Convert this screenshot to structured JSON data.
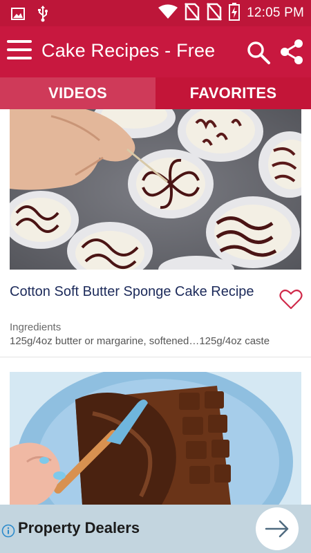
{
  "status_bar": {
    "time": "12:05 PM",
    "icons": [
      "image-icon",
      "usb-icon",
      "wifi-icon",
      "no-sim-icon",
      "no-sim-icon",
      "battery-charging-icon"
    ]
  },
  "app_bar": {
    "title": "Cake Recipes - Free",
    "icons": [
      "menu-icon",
      "search-icon",
      "share-icon"
    ]
  },
  "tabs": [
    {
      "label": "VIDEOS",
      "active": false
    },
    {
      "label": "FAVORITES",
      "active": true
    }
  ],
  "recipes": [
    {
      "title": "Cotton Soft Butter Sponge Cake Recipe",
      "subtitle": "Ingredients",
      "description": "125g/4oz butter or margarine, softened…125g/4oz caste",
      "favorite_icon": "heart-outline-icon"
    }
  ],
  "ad": {
    "text": "Property Dealers",
    "icons": [
      "info-icon",
      "arrow-right-icon"
    ]
  },
  "colors": {
    "status_bar": "#bd1639",
    "app_bar": "#c8183f",
    "tab_bar": "#cf3a59",
    "tab_active": "#c31538",
    "title_text": "#1c2a5a",
    "heart": "#d02a4a",
    "ad_background": "#c3d5df"
  }
}
